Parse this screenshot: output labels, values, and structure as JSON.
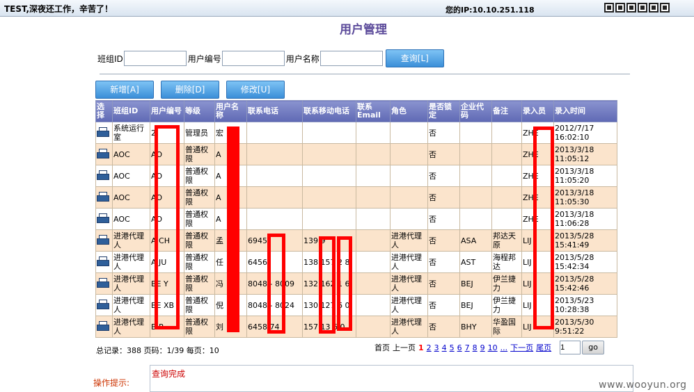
{
  "header": {
    "greeting": "TEST,深夜还工作，辛苦了！",
    "ip_text": "您的IP:10.10.251.118",
    "icons": [
      "toolbar-icon",
      "toolbar-icon",
      "toolbar-icon",
      "toolbar-icon",
      "toolbar-icon",
      "toolbar-icon"
    ]
  },
  "page_title": "用户管理",
  "search": {
    "team_label": "班组ID",
    "user_no_label": "用户编号",
    "user_name_label": "用户名称",
    "team_value": "",
    "user_no_value": "",
    "user_name_value": "",
    "query_label": "查询[L]"
  },
  "toolbar": {
    "add_label": "新增[A]",
    "delete_label": "删除[D]",
    "edit_label": "修改[U]"
  },
  "table": {
    "columns": [
      "选择",
      "班组ID",
      "用户编号",
      "等级",
      "用户名称",
      "联系电话",
      "联系移动电话",
      "联系Email",
      "角色",
      "是否锁定",
      "企业代码",
      "备注",
      "录入员",
      "录入时间"
    ],
    "rows": [
      [
        "",
        "系统运行室",
        "2",
        "管理员",
        "宏",
        "",
        "",
        "",
        "",
        "否",
        "",
        "",
        "ZHE",
        "2012/7/17 16:02:10"
      ],
      [
        "",
        "AOC",
        "AO",
        "普通权限",
        "A",
        "",
        "",
        "",
        "",
        "否",
        "",
        "",
        "ZHE",
        "2013/3/18 11:05:12"
      ],
      [
        "",
        "AOC",
        "AO",
        "普通权限",
        "A",
        "",
        "",
        "",
        "",
        "否",
        "",
        "",
        "ZHE",
        "2013/3/18 11:05:20"
      ],
      [
        "",
        "AOC",
        "AO",
        "普通权限",
        "A",
        "",
        "",
        "",
        "",
        "否",
        "",
        "",
        "ZHE",
        "2013/3/18 11:05:30"
      ],
      [
        "",
        "AOC",
        "AO",
        "普通权限",
        "A",
        "",
        "",
        "",
        "",
        "否",
        "",
        "",
        "ZHE",
        "2013/3/18 11:06:28"
      ],
      [
        "",
        "进港代理人",
        "A      CH",
        "普通权限",
        "孟",
        "6945",
        "139        9",
        "",
        "进港代理人",
        "否",
        "ASA",
        "邦达天原",
        "LIJ",
        "2013/5/28 15:41:49"
      ],
      [
        "",
        "进港代理人",
        "A      JU",
        "普通权限",
        "任",
        "6456",
        "138  157  2  8",
        "",
        "进港代理人",
        "否",
        "AST",
        "海程邦达",
        "LIJ",
        "2013/5/28 15:42:34"
      ],
      [
        "",
        "进港代理人",
        "BE    Y",
        "普通权限",
        "冯",
        "8048         - 8009",
        "132  162  1  6",
        "",
        "进港代理人",
        "否",
        "BEJ",
        "伊兰捷力",
        "LIJ",
        "2013/5/28 15:42:46"
      ],
      [
        "",
        "进港代理人",
        "BE    XB",
        "普通权限",
        "倪",
        "8048         - 8024",
        "130  127  6  0",
        "",
        "进港代理人",
        "否",
        "BEJ",
        "伊兰捷力",
        "LIJ",
        "2013/5/23 10:28:38"
      ],
      [
        "",
        "进港代理人",
        "B       P",
        "普通权限",
        "刘",
        "6458  74",
        "157  13  6  0",
        "",
        "进港代理人",
        "否",
        "BHY",
        "华盈国际",
        "LIJ",
        "2013/5/30 9:51:22"
      ]
    ]
  },
  "pager": {
    "totals": "总记录：388 页码：1/39 每页：10",
    "first": "首页",
    "prev": "上一页",
    "pages": [
      "1",
      "2",
      "3",
      "4",
      "5",
      "6",
      "7",
      "8",
      "9",
      "10"
    ],
    "ellipsis": "...",
    "next": "下一页",
    "last": "尾页",
    "page_input": "1",
    "go_label": "go"
  },
  "operation": {
    "label": "操作提示:",
    "message": "查询完成"
  },
  "watermark": "www.wooyun.org",
  "colors": {
    "title": "#5b4a9a",
    "header_bg": "#6e78c0",
    "row_alt": "#fbe4cc",
    "redaction": "#ff0000",
    "button": "#3b8fd8"
  }
}
